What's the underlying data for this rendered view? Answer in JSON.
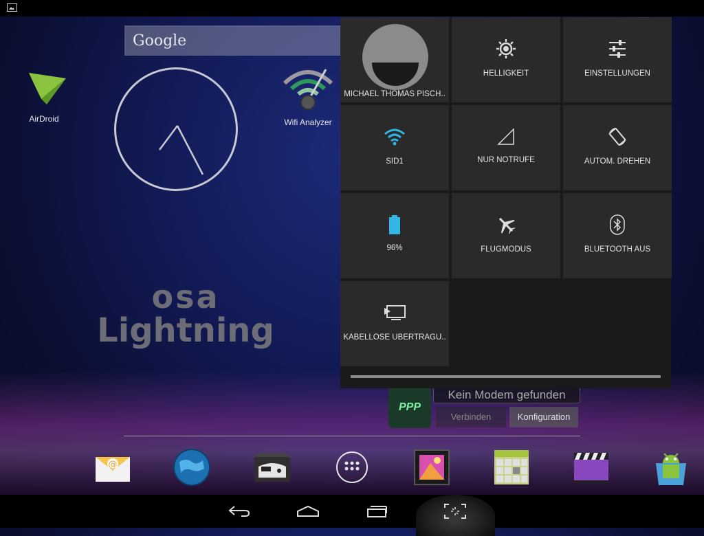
{
  "search": {
    "label": "Google"
  },
  "apps": {
    "airdroid": "AirDroid",
    "wifi_analyzer": "Wifi Analyzer"
  },
  "wallpaper_text": {
    "line1": "osa",
    "line2": "Lightning"
  },
  "quick_settings": {
    "user": "MICHAEL THOMAS PISCH..",
    "brightness": "HELLIGKEIT",
    "settings": "EINSTELLUNGEN",
    "wifi": "SID1",
    "signal": "NUR NOTRUFE",
    "rotate": "AUTOM. DREHEN",
    "battery": "96%",
    "airplane": "FLUGMODUS",
    "bluetooth": "BLUETOOTH AUS",
    "cast": "KABELLOSE ÜBERTRAGU.."
  },
  "ppp_widget": {
    "icon_text": "PPP",
    "status": "Kein Modem gefunden",
    "connect": "Verbinden",
    "config": "Konfiguration"
  },
  "colors": {
    "accent_blue": "#33b5e5",
    "tile_bg": "#2a2a2a"
  }
}
